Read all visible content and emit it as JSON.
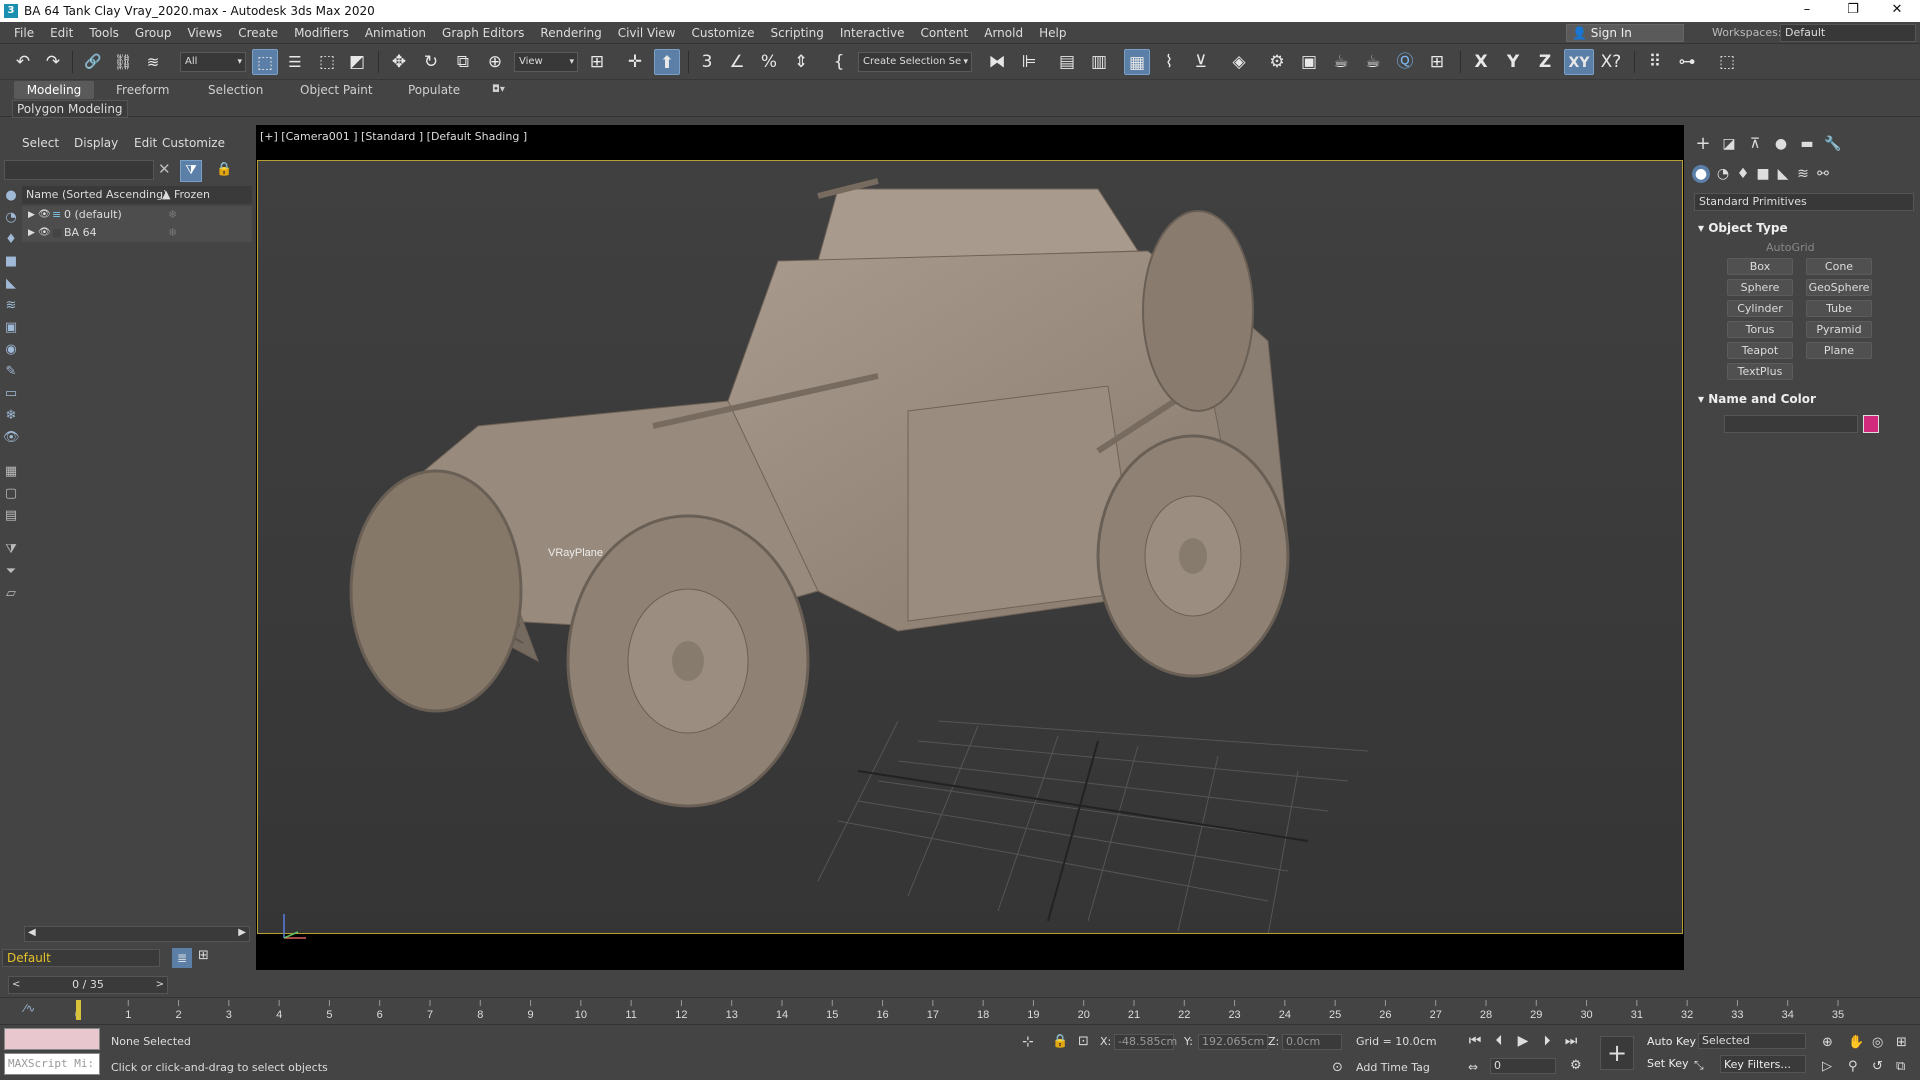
{
  "window": {
    "title": "BA 64 Tank Clay Vray_2020.max - Autodesk 3ds Max 2020",
    "logo": "3",
    "controls": [
      "–",
      "❐",
      "✕"
    ]
  },
  "menu": [
    "File",
    "Edit",
    "Tools",
    "Group",
    "Views",
    "Create",
    "Modifiers",
    "Animation",
    "Graph Editors",
    "Rendering",
    "Civil View",
    "Customize",
    "Scripting",
    "Interactive",
    "Content",
    "Arnold",
    "Help"
  ],
  "account": {
    "sign_in": "Sign In",
    "workspaces_label": "Workspaces:",
    "workspace": "Default"
  },
  "toolbar": {
    "selection_filter": "All",
    "ref_coord": "View",
    "named_selection": "Create Selection Se",
    "axes": [
      "X",
      "Y",
      "Z",
      "XY"
    ],
    "snap_label": "3",
    "icons": {
      "undo": "↶",
      "redo": "↷",
      "link": "🔗",
      "select": "⬚",
      "move": "✥",
      "rotate": "↻"
    }
  },
  "ribbon": {
    "tabs": [
      "Modeling",
      "Freeform",
      "Selection",
      "Object Paint",
      "Populate"
    ],
    "active": "Modeling",
    "sub": "Polygon Modeling"
  },
  "scene_explorer": {
    "menu": [
      "Select",
      "Display",
      "Edit",
      "Customize"
    ],
    "columns": {
      "name": "Name (Sorted Ascending)",
      "frozen": "▲ Frozen"
    },
    "rows": [
      {
        "name": "0 (default)"
      },
      {
        "name": "BA 64"
      }
    ],
    "layer": "Default"
  },
  "viewport": {
    "label": "[+] [Camera001 ] [Standard ] [Default Shading ]",
    "object_label": "VRayPlane",
    "model_color": "#9c8e80"
  },
  "command_panel": {
    "dropdown": "Standard Primitives",
    "object_type_title": "Object Type",
    "autogrid": "AutoGrid",
    "buttons": [
      "Box",
      "Cone",
      "Sphere",
      "GeoSphere",
      "Cylinder",
      "Tube",
      "Torus",
      "Pyramid",
      "Teapot",
      "Plane",
      "TextPlus"
    ],
    "name_color_title": "Name and Color",
    "color": "#d12a7d"
  },
  "timeline": {
    "slider": "0 / 35",
    "ticks": [
      "0",
      "1",
      "2",
      "3",
      "4",
      "5",
      "6",
      "7",
      "8",
      "9",
      "10",
      "11",
      "12",
      "13",
      "14",
      "15",
      "16",
      "17",
      "18",
      "19",
      "20",
      "21",
      "22",
      "23",
      "24",
      "25",
      "26",
      "27",
      "28",
      "29",
      "30",
      "31",
      "32",
      "33",
      "34",
      "35"
    ]
  },
  "status": {
    "maxscript": "MAXScript Mi:",
    "selection": "None Selected",
    "prompt": "Click or click-and-drag to select objects",
    "x_label": "X:",
    "x": "-48.585cm",
    "y_label": "Y:",
    "y": "192.065cm",
    "z_label": "Z:",
    "z": "0.0cm",
    "grid": "Grid = 10.0cm",
    "add_time_tag": "Add Time Tag",
    "auto_key": "Auto Key",
    "set_key": "Set Key",
    "key_mode": "Selected",
    "key_filters": "Key Filters...",
    "frame": "0"
  }
}
